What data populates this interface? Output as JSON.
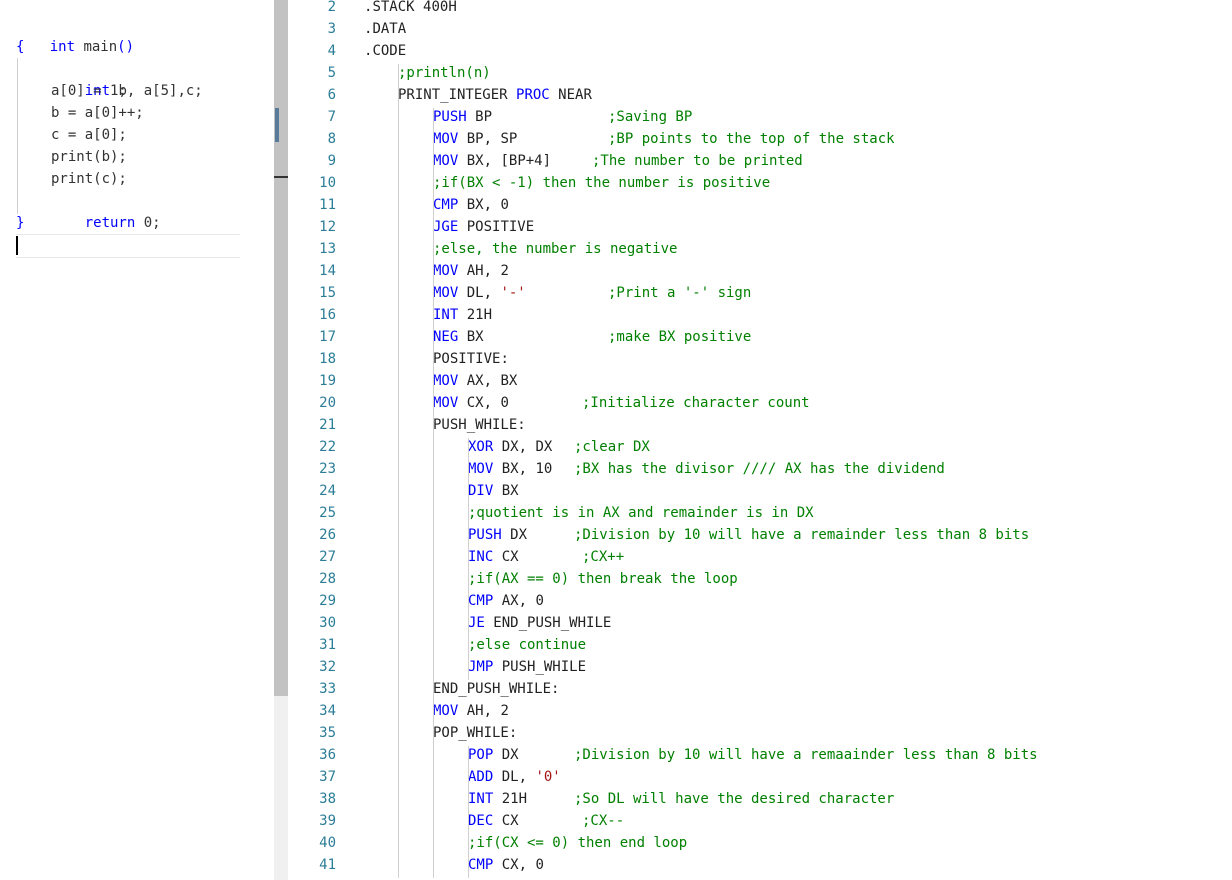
{
  "c_editor": {
    "lines": [
      {
        "code": "int main()"
      },
      {
        "code": "{"
      },
      {
        "code": "int b, a[5],c;"
      },
      {
        "code": "a[0] = 1;"
      },
      {
        "code": "b = a[0]++;"
      },
      {
        "code": "c = a[0];"
      },
      {
        "code": "print(b);"
      },
      {
        "code": "print(c);"
      },
      {
        "code": "return 0;"
      },
      {
        "code": "}"
      }
    ]
  },
  "asm_editor": {
    "lines": [
      {
        "n": "2",
        "indent": 0,
        "code": ".STACK 400H",
        "comment": ""
      },
      {
        "n": "3",
        "indent": 0,
        "code": ".DATA",
        "comment": ""
      },
      {
        "n": "4",
        "indent": 0,
        "code": ".CODE",
        "comment": ""
      },
      {
        "n": "5",
        "indent": 1,
        "code": "",
        "comment": ";println(n)"
      },
      {
        "n": "6",
        "indent": 1,
        "code": "PRINT_INTEGER PROC NEAR",
        "comment": ""
      },
      {
        "n": "7",
        "indent": 2,
        "code": "PUSH BP",
        "comment": ";Saving BP"
      },
      {
        "n": "8",
        "indent": 2,
        "code": "MOV BP, SP",
        "comment": ";BP points to the top of the stack"
      },
      {
        "n": "9",
        "indent": 2,
        "code": "MOV BX, [BP+4]",
        "comment": ";The number to be printed"
      },
      {
        "n": "10",
        "indent": 2,
        "code": "",
        "comment": ";if(BX < -1) then the number is positive"
      },
      {
        "n": "11",
        "indent": 2,
        "code": "CMP BX, 0",
        "comment": ""
      },
      {
        "n": "12",
        "indent": 2,
        "code": "JGE POSITIVE",
        "comment": ""
      },
      {
        "n": "13",
        "indent": 2,
        "code": "",
        "comment": ";else, the number is negative"
      },
      {
        "n": "14",
        "indent": 2,
        "code": "MOV AH, 2",
        "comment": ""
      },
      {
        "n": "15",
        "indent": 2,
        "code": "MOV DL, '-'",
        "comment": ";Print a '-' sign"
      },
      {
        "n": "16",
        "indent": 2,
        "code": "INT 21H",
        "comment": ""
      },
      {
        "n": "17",
        "indent": 2,
        "code": "NEG BX",
        "comment": ";make BX positive"
      },
      {
        "n": "18",
        "indent": 2,
        "code": "POSITIVE:",
        "comment": ""
      },
      {
        "n": "19",
        "indent": 2,
        "code": "MOV AX, BX",
        "comment": ""
      },
      {
        "n": "20",
        "indent": 2,
        "code": "MOV CX, 0",
        "comment": ";Initialize character count"
      },
      {
        "n": "21",
        "indent": 2,
        "code": "PUSH_WHILE:",
        "comment": ""
      },
      {
        "n": "22",
        "indent": 3,
        "code": "XOR DX, DX",
        "comment": ";clear DX"
      },
      {
        "n": "23",
        "indent": 3,
        "code": "MOV BX, 10",
        "comment": ";BX has the divisor //// AX has the dividend"
      },
      {
        "n": "24",
        "indent": 3,
        "code": "DIV BX",
        "comment": ""
      },
      {
        "n": "25",
        "indent": 3,
        "code": "",
        "comment": ";quotient is in AX and remainder is in DX"
      },
      {
        "n": "26",
        "indent": 3,
        "code": "PUSH DX",
        "comment": ";Division by 10 will have a remainder less than 8 bits"
      },
      {
        "n": "27",
        "indent": 3,
        "code": "INC CX",
        "comment": ";CX++"
      },
      {
        "n": "28",
        "indent": 3,
        "code": "",
        "comment": ";if(AX == 0) then break the loop"
      },
      {
        "n": "29",
        "indent": 3,
        "code": "CMP AX, 0",
        "comment": ""
      },
      {
        "n": "30",
        "indent": 3,
        "code": "JE END_PUSH_WHILE",
        "comment": ""
      },
      {
        "n": "31",
        "indent": 3,
        "code": "",
        "comment": ";else continue"
      },
      {
        "n": "32",
        "indent": 3,
        "code": "JMP PUSH_WHILE",
        "comment": ""
      },
      {
        "n": "33",
        "indent": 2,
        "code": "END_PUSH_WHILE:",
        "comment": ""
      },
      {
        "n": "34",
        "indent": 2,
        "code": "MOV AH, 2",
        "comment": ""
      },
      {
        "n": "35",
        "indent": 2,
        "code": "POP_WHILE:",
        "comment": ""
      },
      {
        "n": "36",
        "indent": 3,
        "code": "POP DX",
        "comment": ";Division by 10 will have a remaainder less than 8 bits"
      },
      {
        "n": "37",
        "indent": 3,
        "code": "ADD DL, '0'",
        "comment": ""
      },
      {
        "n": "38",
        "indent": 3,
        "code": "INT 21H",
        "comment": ";So DL will have the desired character"
      },
      {
        "n": "39",
        "indent": 3,
        "code": "DEC CX",
        "comment": ";CX--"
      },
      {
        "n": "40",
        "indent": 3,
        "code": "",
        "comment": ";if(CX <= 0) then end loop"
      },
      {
        "n": "41",
        "indent": 3,
        "code": "CMP CX, 0",
        "comment": ""
      }
    ]
  },
  "colors": {
    "keyword": "#0000ff",
    "comment": "#008000",
    "string": "#a31515",
    "line_number": "#2b7d97"
  }
}
